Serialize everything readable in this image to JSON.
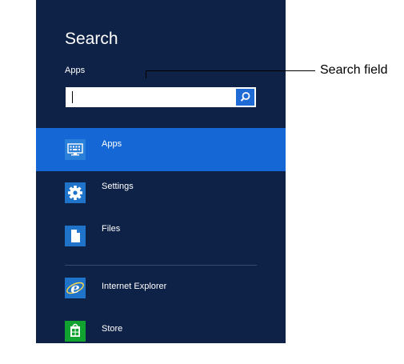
{
  "charm": {
    "title": "Search",
    "scope_label": "Apps",
    "search": {
      "value": "",
      "placeholder": ""
    },
    "scopes": [
      {
        "label": "Apps",
        "icon": "keyboard-icon",
        "selected": true
      },
      {
        "label": "Settings",
        "icon": "gear-icon",
        "selected": false
      },
      {
        "label": "Files",
        "icon": "document-icon",
        "selected": false
      }
    ],
    "apps": [
      {
        "label": "Internet Explorer",
        "icon": "internet-explorer-icon"
      },
      {
        "label": "Store",
        "icon": "store-icon"
      }
    ]
  },
  "callout": {
    "label": "Search field"
  },
  "colors": {
    "panel_bg": "#0e2146",
    "selected_bg": "#1467d5",
    "tile_blue": "#1f74c9",
    "search_button": "#1e6bd6",
    "store_green": "#10a32f"
  }
}
